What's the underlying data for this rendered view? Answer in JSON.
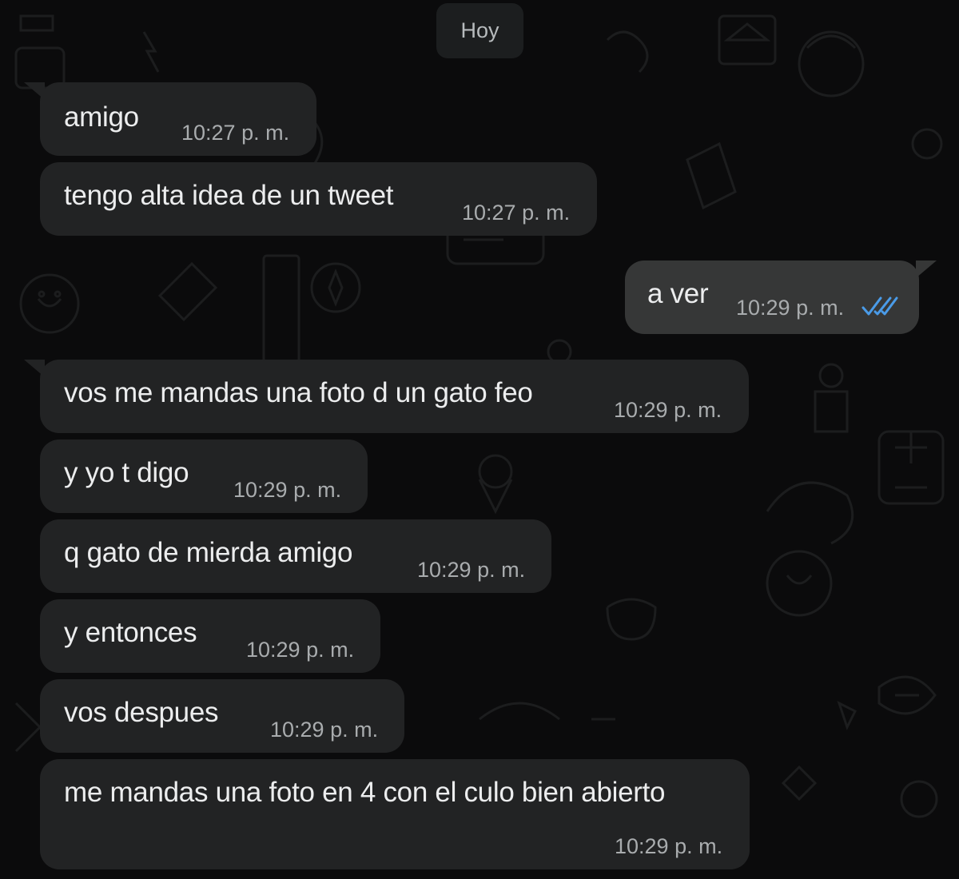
{
  "chat": {
    "date_separator": "Hoy",
    "messages": [
      {
        "direction": "in",
        "text": "amigo",
        "time": "10:27 p. m."
      },
      {
        "direction": "in",
        "text": "tengo alta idea de un tweet",
        "time": "10:27 p. m."
      },
      {
        "direction": "out",
        "text": "a ver",
        "time": "10:29 p. m.",
        "status": "read",
        "status_icon": "double-check-icon",
        "status_color": "#4a9be8"
      },
      {
        "direction": "in",
        "text": "vos me mandas una foto d un gato feo",
        "time": "10:29 p. m."
      },
      {
        "direction": "in",
        "text": "y yo t digo",
        "time": "10:29 p. m."
      },
      {
        "direction": "in",
        "text": "q gato de mierda amigo",
        "time": "10:29 p. m."
      },
      {
        "direction": "in",
        "text": "y entonces",
        "time": "10:29 p. m."
      },
      {
        "direction": "in",
        "text": "vos despues",
        "time": "10:29 p. m."
      },
      {
        "direction": "in",
        "text": "me mandas una foto en 4 con el culo bien abierto",
        "time": "10:29 p. m."
      }
    ]
  },
  "colors": {
    "background": "#0b0b0c",
    "incoming_bubble": "#222324",
    "outgoing_bubble": "#363737",
    "read_ticks": "#4a9be8"
  }
}
